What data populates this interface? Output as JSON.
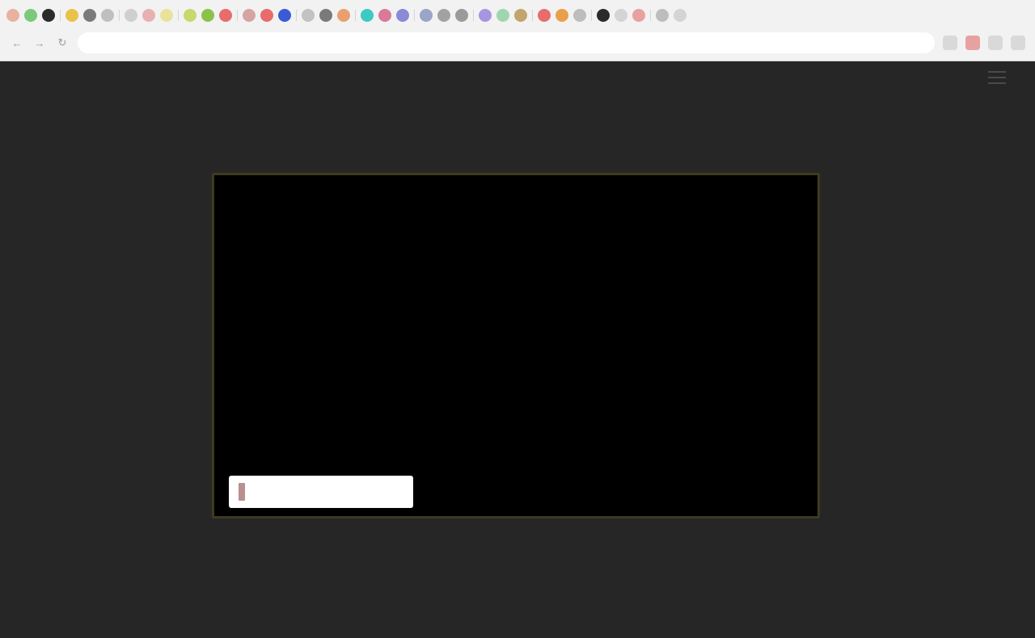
{
  "browser": {
    "tab_favicon_colors": [
      "#e9b1a0",
      "#7bc97b",
      "#2b2b2b",
      "#e8c24a",
      "#7a7a7a",
      "#bfbfbf",
      "#cfcfcf",
      "#e8b1b1",
      "#e8e39a",
      "#c7d86e",
      "#8bc34a",
      "#e86c6c",
      "#d6a3a3",
      "#e86c6c",
      "#3b5bd6",
      "#c2c2c2",
      "#7a7a7a",
      "#e8a070",
      "#3dc9c4",
      "#d97a9a",
      "#8a8ad6",
      "#9aa5c7",
      "#a2a2a2",
      "#9a9a9a",
      "#a895e0",
      "#9fd6b0",
      "#c2a46e",
      "#e86c6c",
      "#e8a04a",
      "#bdbdbd",
      "#2b2b2b",
      "#d4d4d4",
      "#e8a0a0",
      "#bdbdbd",
      "#d4d4d4"
    ],
    "url": "",
    "nav_icons": [
      "back-icon",
      "forward-icon",
      "reload-icon",
      "home-icon"
    ]
  },
  "site": {
    "logo_text": "",
    "nav_items": [
      "",
      "",
      "",
      ""
    ]
  },
  "modal": {
    "title": "",
    "body": "",
    "links_label": "",
    "links": [
      "",
      ""
    ],
    "accept_label": ""
  },
  "colors": {
    "page_bg": "#262626",
    "modal_bg": "#000000",
    "title_color": "#8a4fe0",
    "modal_border": "#3d3a1f"
  }
}
